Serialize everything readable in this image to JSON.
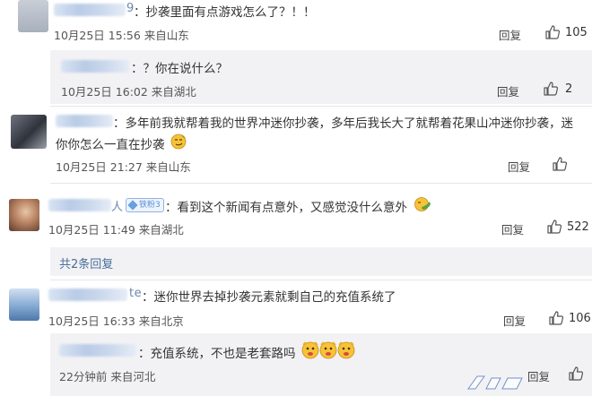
{
  "comments": [
    {
      "name_tail": "9",
      "text": "：抄袭里面有点游戏怎么了？！！",
      "time": "10月25日 15:56",
      "location": "来自山东",
      "reply": "回复",
      "likes": "105",
      "replies": [
        {
          "text": "：？你在说什么？",
          "time": "10月25日 16:02",
          "location": "来自湖北",
          "reply": "回复",
          "likes": "2"
        }
      ]
    },
    {
      "name_tail": "：",
      "text_line1": "：多年前我就帮着我的世界冲迷你抄袭，多年后我长大了就帮着花果山冲迷你抄袭，迷",
      "text_line2": "你你怎么一直在抄袭",
      "time": "10月25日 21:27",
      "location": "来自山东",
      "reply": "回复",
      "likes": ""
    },
    {
      "name_tail": "人",
      "badge": "铁粉3",
      "text": "：看到这个新闻有点意外，又感觉没什么意外",
      "time": "10月25日 11:49",
      "location": "来自湖北",
      "reply": "回复",
      "likes": "522",
      "more_replies": "共2条回复"
    },
    {
      "name_tail": "te",
      "text": "：迷你世界去掉抄袭元素就剩自己的充值系统了",
      "time": "10月25日 16:33",
      "location": "来自北京",
      "reply": "回复",
      "likes": "106",
      "replies": [
        {
          "text": "：充值系统，不也是老套路吗",
          "time": "22分钟前",
          "location": "来自河北",
          "reply": "回复",
          "likes": ""
        }
      ]
    }
  ],
  "icons": {
    "like": "thumbs-up-icon",
    "emoji_smirk": "smirk-emoji",
    "emoji_facepalm": "facepalm-emoji",
    "emoji_cheek": "cheeky-emoji"
  },
  "colors": {
    "link": "#4a6d9a",
    "sub_box_bg": "#f2f2f5",
    "text": "#333333"
  }
}
